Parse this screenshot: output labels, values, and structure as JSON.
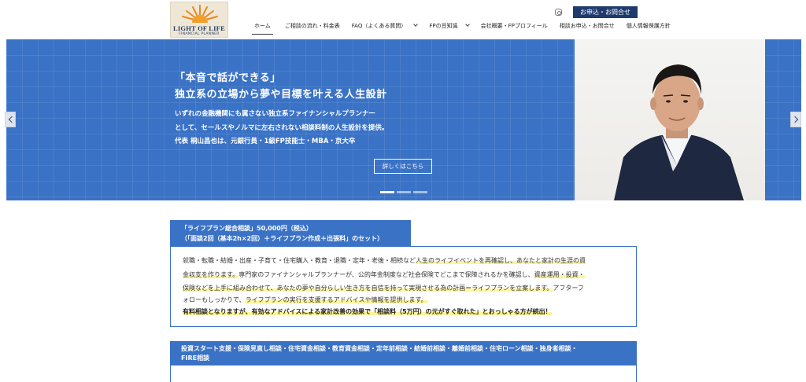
{
  "logo": {
    "main": "LIGHT OF LIFE",
    "sub": "FINANCIAL PLANNER"
  },
  "header": {
    "contact_label": "お申込・お問合せ",
    "nav": [
      {
        "label": "ホーム"
      },
      {
        "label": "ご相談の流れ・料金表"
      },
      {
        "label": "FAQ（よくある質問）"
      },
      {
        "label": "FPの豆知識"
      },
      {
        "label": "会社概要・FPプロフィール"
      },
      {
        "label": "相談お申込・お問合せ"
      },
      {
        "label": "個人情報保護方針"
      }
    ]
  },
  "hero": {
    "tagline": "「本音で話ができる」",
    "headline": "独立系の立場から夢や目標を叶える人生設計",
    "desc": [
      "いずれの金融機関にも属さない独立系ファイナンシャルプランナー",
      "として、セールスやノルマに左右されない相談料制の人生設計を提供。",
      "代表 桐山昌也は、元銀行員・1級FP技能士・MBA・京大卒"
    ],
    "button_label": "詳しくはこちら"
  },
  "plan1": {
    "header_lines": [
      "「ライフプラン総合相談」50,000円（税込）",
      "（「面談2回（基本2h×2回）＋ライフプラン作成＋出張料」のセット）"
    ],
    "l1a": "就職・転職・結婚・出産・子育て・住宅購入・教育・退職・定年・老後・相続など",
    "l1b": "人生のライフイベントを再確認し、あなたと家計の生涯の資",
    "l2a": "金収支を作ります。",
    "l2b": "専門家のファイナンシャルプランナーが、公的年金制度など社会保険でどこまで保障されるかを確認し、",
    "l2c": "資産運用・投資・",
    "l3a": "保険などを上手に組み合わせて、あなたの夢や自分らしい生き方を自信を持って実現させる為の計画＝ライフプランを立案します。",
    "l3b": "アフターフ",
    "l4a": "ォローもしっかりで、",
    "l4b": "ライフプランの実行を支援するアドバイスや情報を提供します。",
    "l5": "有料相談となりますが、有効なアドバイスによる家計改善の効果で「相談料（5万円）の元がすぐ取れた」とおっしゃる方が続出！"
  },
  "plan2": {
    "header_lines": [
      "投資スタート支援・保険見直し相談・住宅資金相談・教育資金相談・定年前相談・結婚前相談・離婚前相談・住宅ローン相談・独身者相談・",
      "FIRE相談"
    ]
  }
}
